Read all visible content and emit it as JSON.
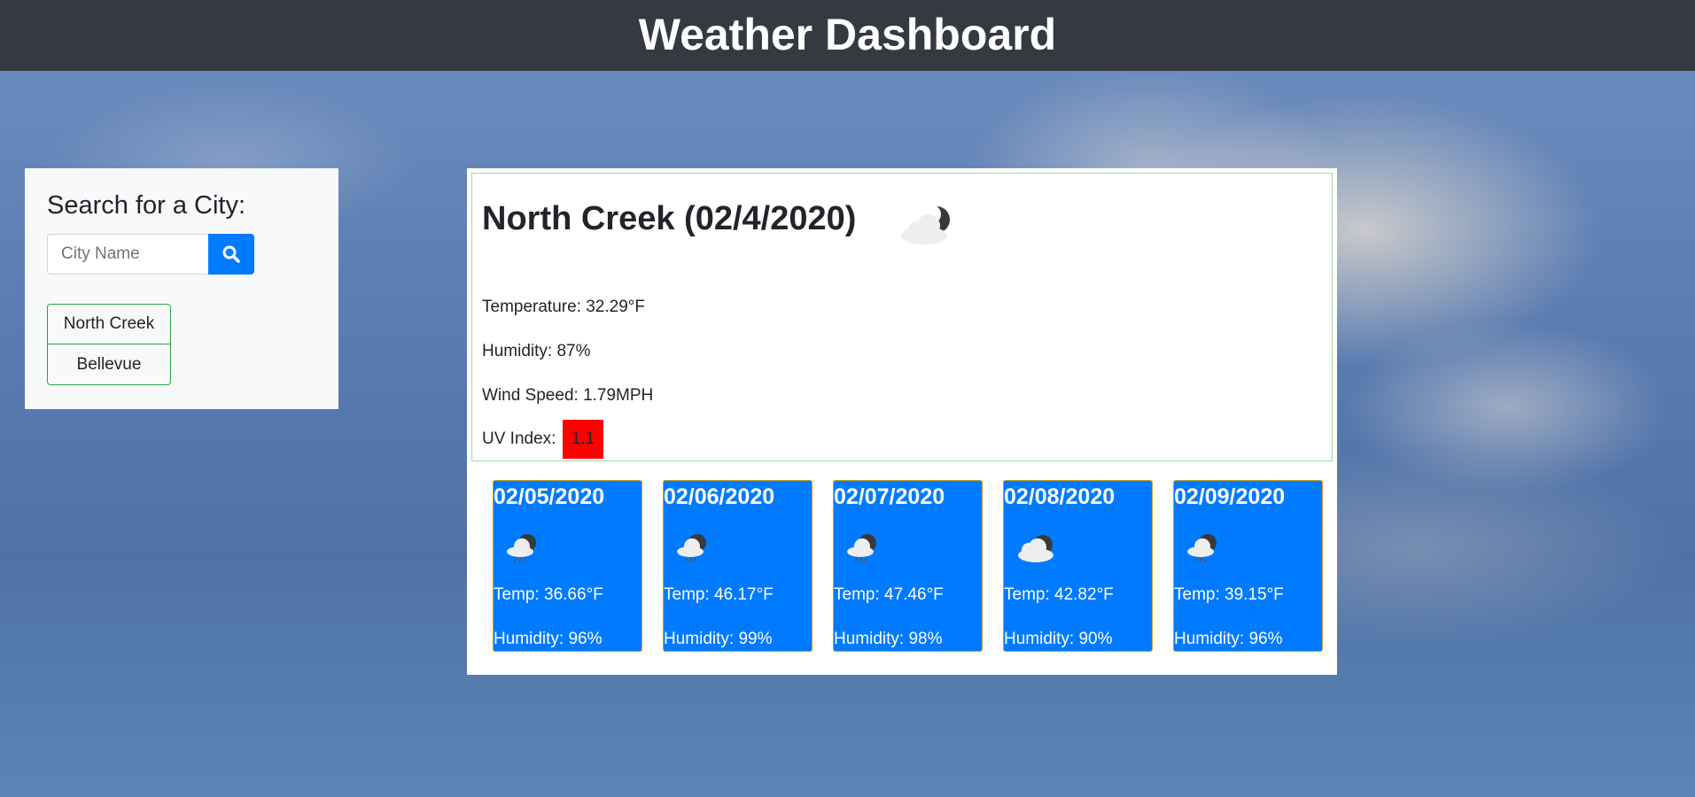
{
  "header": {
    "title": "Weather Dashboard"
  },
  "search": {
    "heading": "Search for a City:",
    "placeholder": "City Name",
    "history": [
      "North Creek",
      "Bellevue"
    ]
  },
  "current": {
    "title": "North Creek (02/4/2020)",
    "icon": "partly-cloudy-night-icon",
    "temperature": "Temperature: 32.29°F",
    "humidity": "Humidity: 87%",
    "wind": "Wind Speed: 1.79MPH",
    "uv_label": "UV Index:",
    "uv_value": "1.1",
    "uv_color": "#ff0000"
  },
  "forecast": [
    {
      "date": "02/05/2020",
      "icon": "rain-cloud-icon",
      "temp": "Temp: 36.66°F",
      "humidity": "Humidity: 96%"
    },
    {
      "date": "02/06/2020",
      "icon": "rain-cloud-icon",
      "temp": "Temp: 46.17°F",
      "humidity": "Humidity: 99%"
    },
    {
      "date": "02/07/2020",
      "icon": "rain-cloud-icon",
      "temp": "Temp: 47.46°F",
      "humidity": "Humidity: 98%"
    },
    {
      "date": "02/08/2020",
      "icon": "cloud-icon",
      "temp": "Temp: 42.82°F",
      "humidity": "Humidity: 90%"
    },
    {
      "date": "02/09/2020",
      "icon": "rain-cloud-icon",
      "temp": "Temp: 39.15°F",
      "humidity": "Humidity: 96%"
    }
  ],
  "colors": {
    "header_bg": "#343a40",
    "accent": "#007bff",
    "history_border": "#28a745"
  }
}
